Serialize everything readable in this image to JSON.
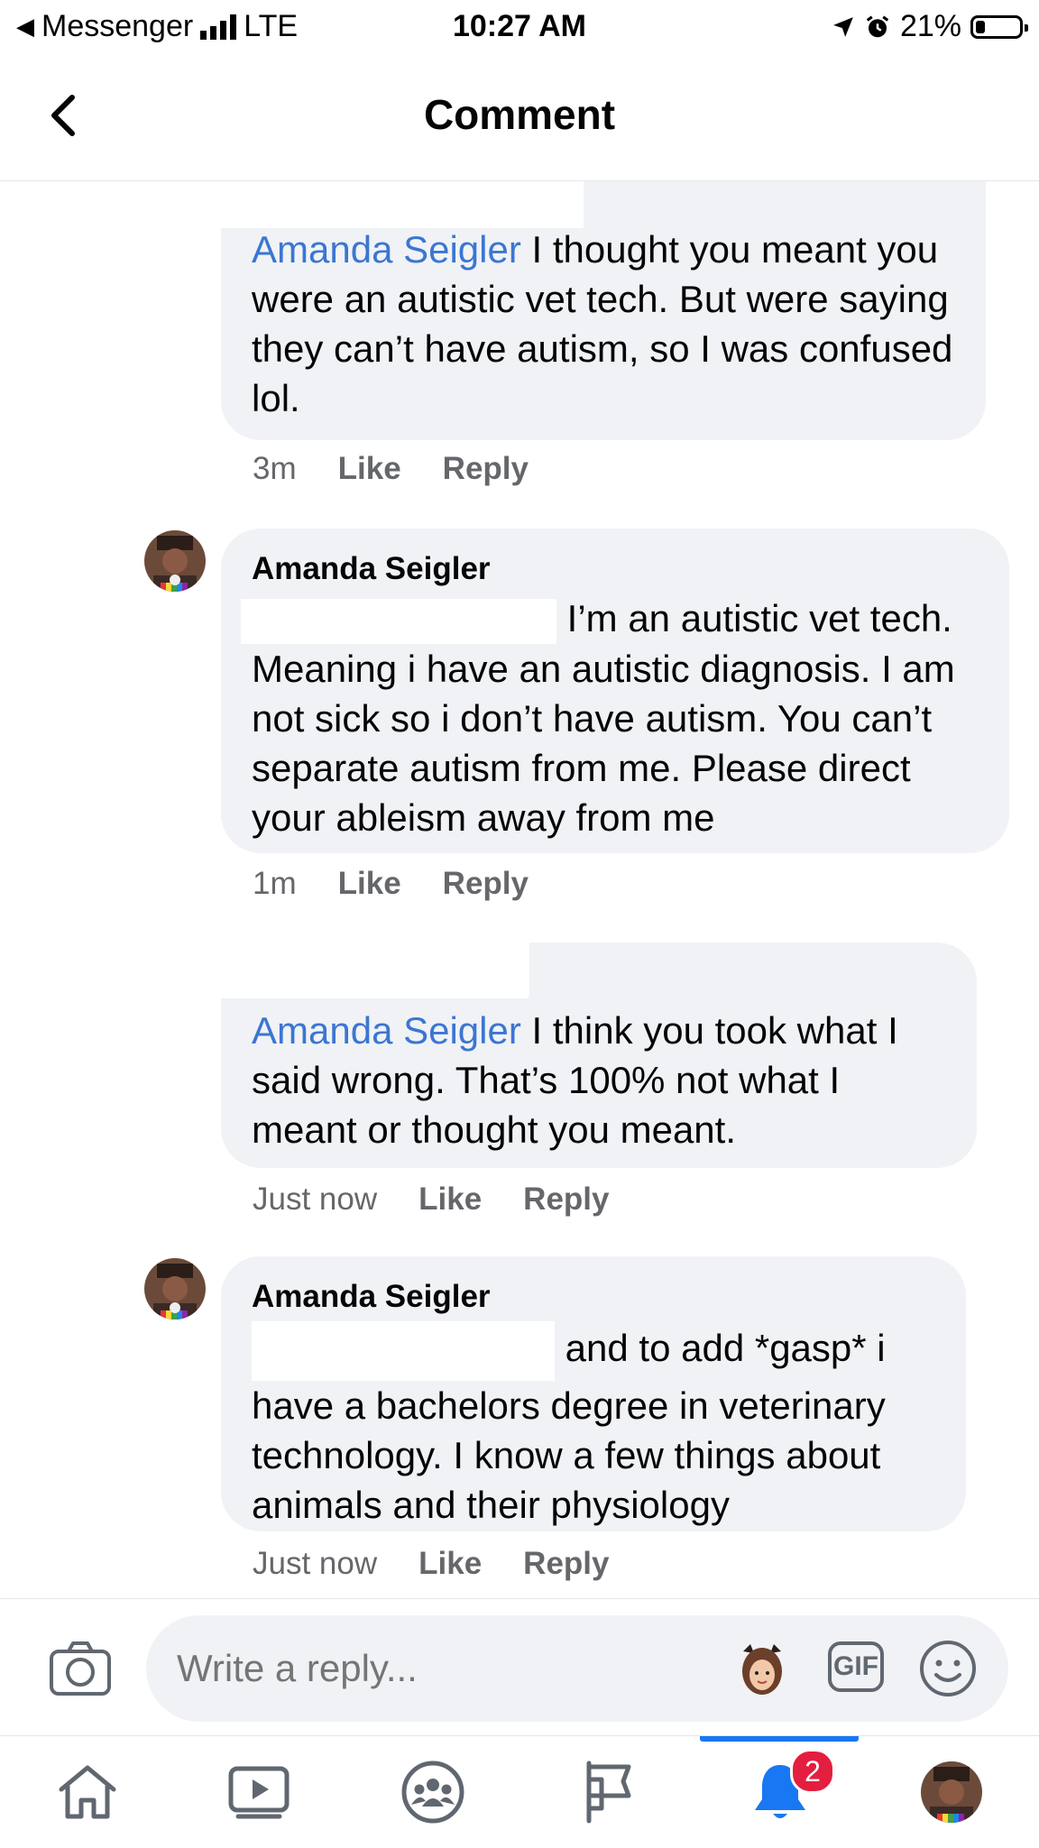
{
  "status_bar": {
    "back_app": "Messenger",
    "network": "LTE",
    "time": "10:27 AM",
    "battery": "21%",
    "battery_level": 0.21
  },
  "header": {
    "title": "Comment"
  },
  "comments": [
    {
      "author": "",
      "mention": "Amanda Seigler",
      "text": " I thought you meant you were an autistic vet tech. But were saying they can’t have autism, so I was confused lol.",
      "time": "3m",
      "like": "Like",
      "reply": "Reply"
    },
    {
      "author": "Amanda Seigler",
      "text": "I’m an autistic vet tech. Meaning i have an autistic diagnosis. I am not sick so i don’t have autism. You can’t separate autism from me. Please direct your ableism away from me",
      "time": "1m",
      "like": "Like",
      "reply": "Reply"
    },
    {
      "author": "",
      "mention": "Amanda Seigler",
      "text": " I think you took what I said wrong. That’s 100% not what I meant or thought you meant.",
      "time": "Just now",
      "like": "Like",
      "reply": "Reply"
    },
    {
      "author": "Amanda Seigler",
      "text": "and to add *gasp* i have a bachelors degree in veterinary technology. I know a few things about animals and their physiology",
      "time": "Just now",
      "like": "Like",
      "reply": "Reply"
    }
  ],
  "composer": {
    "placeholder": "Write a reply...",
    "gif_label": "GIF"
  },
  "nav": {
    "notifications_badge": "2",
    "active": "notifications"
  },
  "colors": {
    "accent": "#1877f2",
    "mention": "#3b76d2",
    "badge": "#e41e3f",
    "bubble": "#f0f2f5"
  }
}
